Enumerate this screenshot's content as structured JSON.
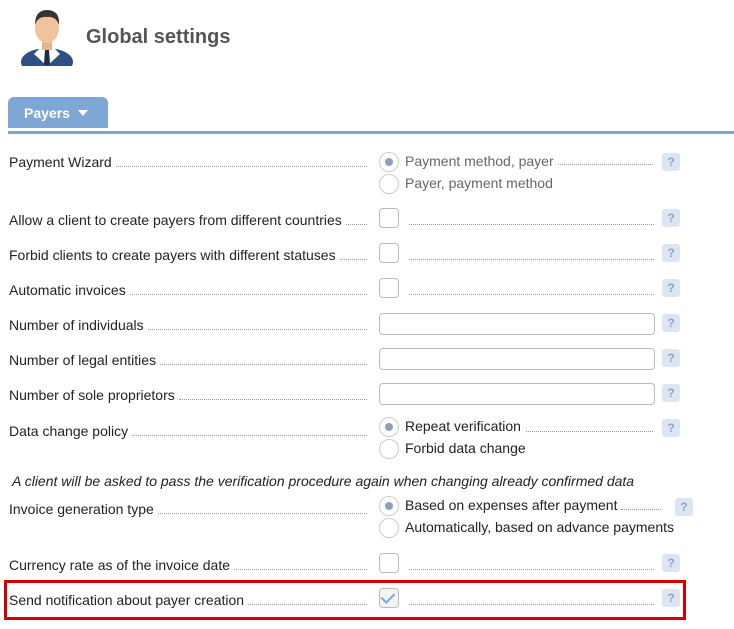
{
  "header": {
    "title": "Global settings"
  },
  "tabs": [
    {
      "label": "Payers"
    }
  ],
  "settings": {
    "payment_wizard": {
      "label": "Payment Wizard",
      "options": [
        "Payment method, payer",
        "Payer, payment method"
      ],
      "selected": 0
    },
    "allow_different_countries": {
      "label": "Allow a client to create payers from different countries",
      "checked": false
    },
    "forbid_different_statuses": {
      "label": "Forbid clients to create payers with different statuses",
      "checked": false
    },
    "automatic_invoices": {
      "label": "Automatic invoices",
      "checked": false
    },
    "num_individuals": {
      "label": "Number of individuals",
      "value": ""
    },
    "num_legal_entities": {
      "label": "Number of legal entities",
      "value": ""
    },
    "num_sole_proprietors": {
      "label": "Number of sole proprietors",
      "value": ""
    },
    "data_change_policy": {
      "label": "Data change policy",
      "options": [
        "Repeat verification",
        "Forbid data change"
      ],
      "selected": 0,
      "note": "A client will be asked to pass the verification procedure again when changing already confirmed data"
    },
    "invoice_generation_type": {
      "label": "Invoice generation type",
      "options": [
        "Based on expenses after payment",
        "Automatically, based on advance payments"
      ],
      "selected": 0
    },
    "currency_rate_invoice_date": {
      "label": "Currency rate as of the invoice date",
      "checked": false
    },
    "send_notification_payer_creation": {
      "label": "Send notification about payer creation",
      "checked": true
    }
  },
  "help_label": "?",
  "colors": {
    "accent": "#7fa7d6",
    "highlight": "#d40000"
  }
}
